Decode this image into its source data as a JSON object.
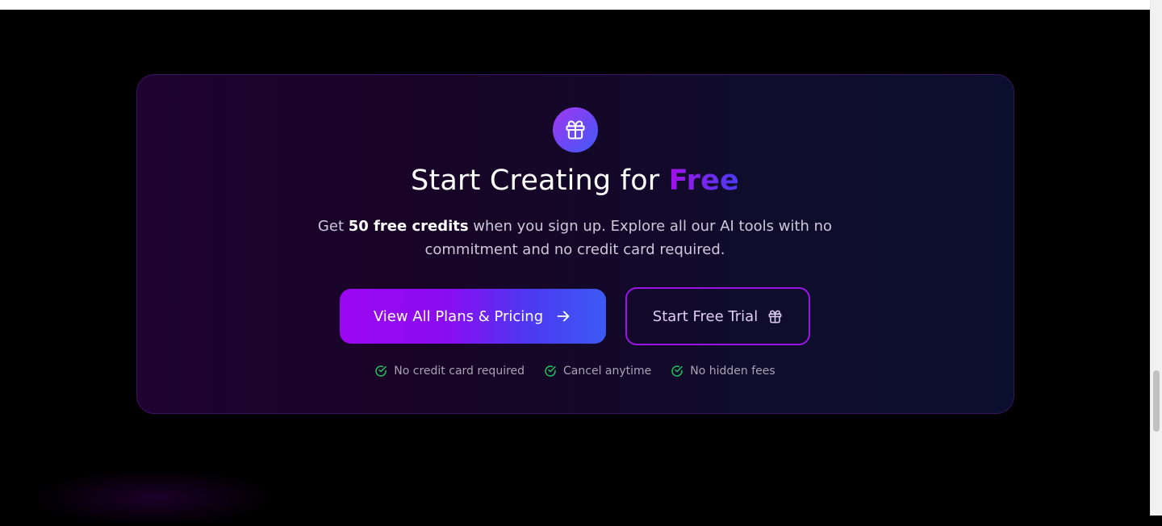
{
  "cta": {
    "title_main": "Start Creating for ",
    "title_accent": "Free",
    "subtitle_prefix": "Get ",
    "subtitle_bold": "50 free credits",
    "subtitle_suffix": " when you sign up. Explore all our AI tools with no commitment and no credit card required.",
    "primary_button": {
      "label": "View All Plans & Pricing",
      "icon": "arrow-right-icon"
    },
    "secondary_button": {
      "label": "Start Free Trial",
      "icon": "gift-icon"
    },
    "badge_icon": "gift-icon",
    "features": [
      {
        "label": "No credit card required",
        "icon": "check-circle-icon"
      },
      {
        "label": "Cancel anytime",
        "icon": "check-circle-icon"
      },
      {
        "label": "No hidden fees",
        "icon": "check-circle-icon"
      }
    ]
  },
  "colors": {
    "accent_purple": "#9b07f0",
    "accent_blue": "#3b5af5",
    "check_green": "#22c55e",
    "card_border": "#3d1262",
    "background": "#000000"
  }
}
